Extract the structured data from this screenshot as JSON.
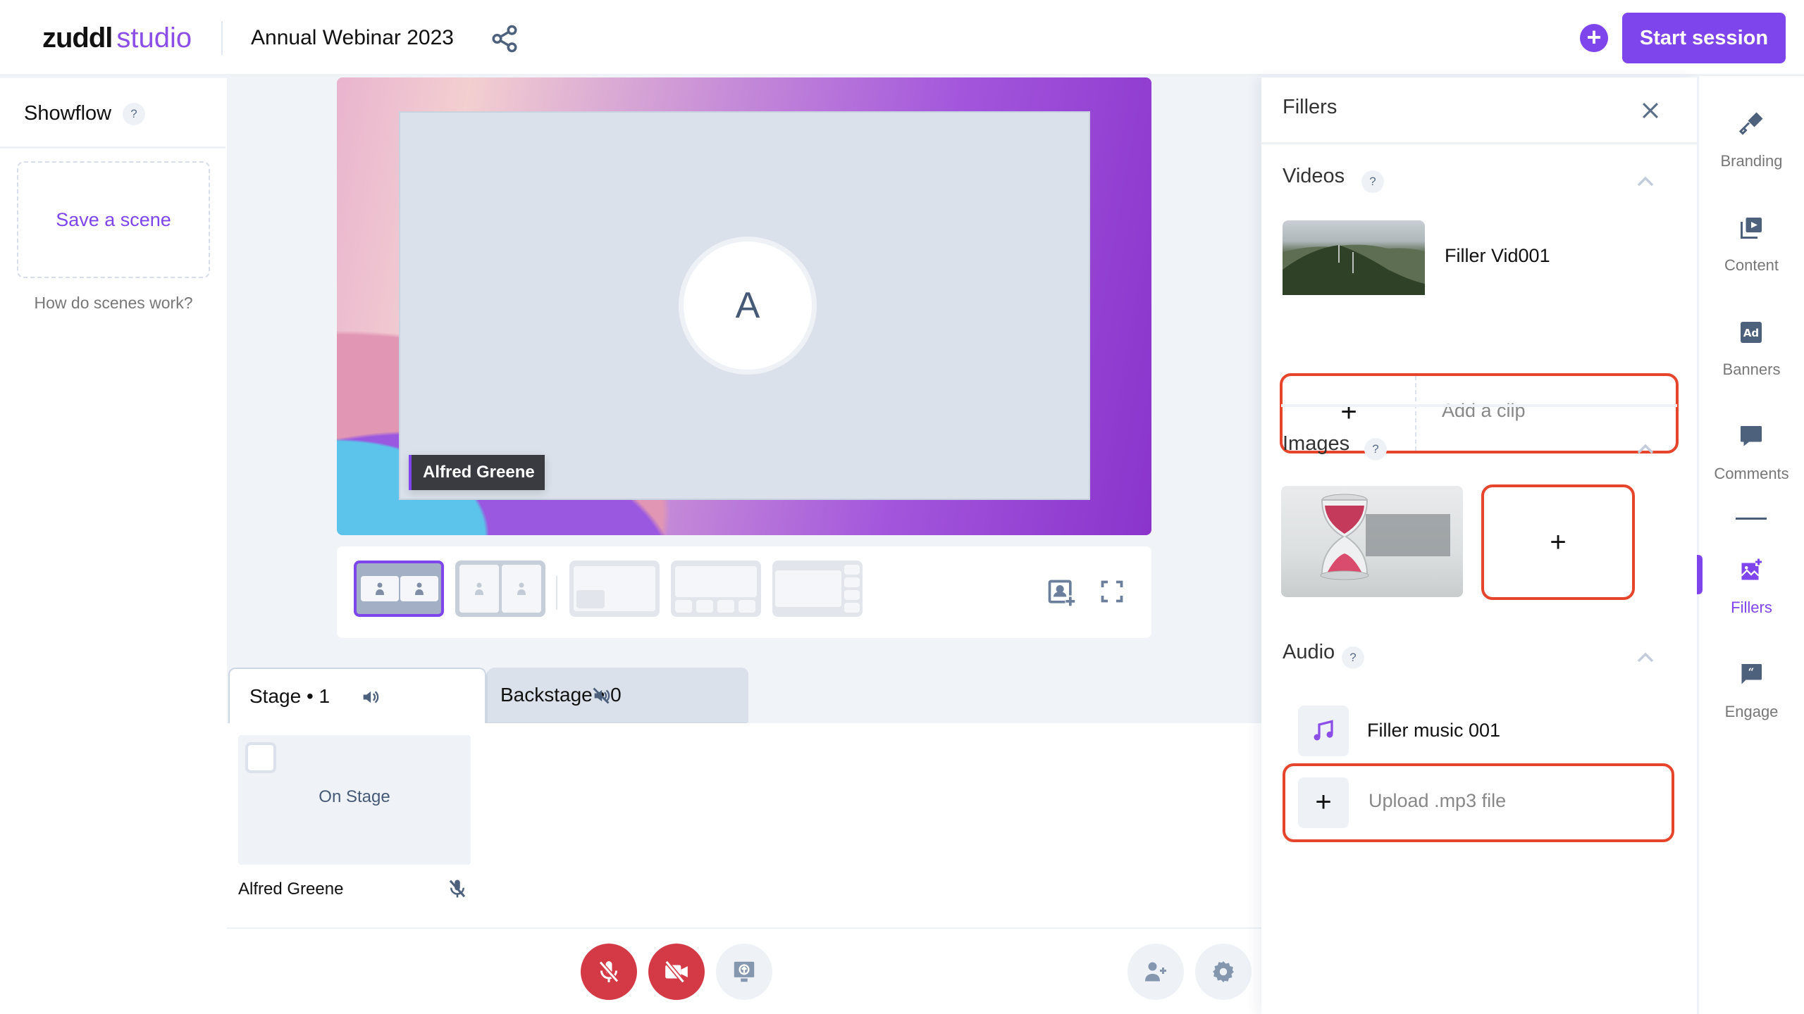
{
  "header": {
    "brand": "zuddl",
    "product": "studio",
    "event_title": "Annual Webinar 2023",
    "share_icon": "share-icon",
    "add_icon": "plus-circle-icon",
    "start_session_label": "Start session",
    "accent_color": "#7f45ec"
  },
  "showflow": {
    "title": "Showflow",
    "help": "?",
    "save_scene_label": "Save a scene",
    "help_link": "How do scenes work?"
  },
  "stage": {
    "avatar_initial": "A",
    "name_tag": "Alfred Greene",
    "layouts": [
      {
        "name": "two-up-side-by-side",
        "selected": true
      },
      {
        "name": "two-up-full",
        "selected": false
      },
      {
        "name": "picture-in-picture",
        "selected": false
      },
      {
        "name": "main-with-bottom-strip",
        "selected": false
      },
      {
        "name": "main-with-side-strip",
        "selected": false
      }
    ],
    "tools": [
      "add-to-stage-icon",
      "fullscreen-icon"
    ]
  },
  "tabs": [
    {
      "label": "Stage • 1",
      "icon": "speaker-on-icon",
      "active": true
    },
    {
      "label": "Backstage • 0",
      "icon": "speaker-muted-icon",
      "active": false
    }
  ],
  "participants": [
    {
      "name": "Alfred Greene",
      "status": "On Stage",
      "mic": "muted"
    }
  ],
  "controls": {
    "left": [
      {
        "name": "mic-off",
        "state": "off",
        "color": "#d33a46"
      },
      {
        "name": "camera-off",
        "state": "off",
        "color": "#d33a46"
      },
      {
        "name": "share-screen",
        "state": "idle"
      }
    ],
    "right": [
      {
        "name": "invite-person"
      },
      {
        "name": "settings"
      }
    ]
  },
  "fillers": {
    "title": "Fillers",
    "videos": {
      "title": "Videos",
      "help": "?",
      "items": [
        {
          "name": "Filler Vid001"
        }
      ],
      "add_label": "+",
      "add_text": "Add a clip"
    },
    "images": {
      "title": "Images",
      "help": "?",
      "items": [
        {
          "name": "hourglass"
        }
      ],
      "add_label": "+"
    },
    "audio": {
      "title": "Audio",
      "help": "?",
      "items": [
        {
          "name": "Filler music 001"
        }
      ],
      "add_label": "+",
      "add_text": "Upload .mp3 file"
    },
    "highlight_color": "#e6452c"
  },
  "rail": {
    "items": [
      {
        "label": "Branding",
        "icon": "paint-roller-icon",
        "active": false
      },
      {
        "label": "Content",
        "icon": "video-library-icon",
        "active": false
      },
      {
        "label": "Banners",
        "icon": "ad-icon",
        "active": false
      },
      {
        "label": "Comments",
        "icon": "comment-icon",
        "active": false
      },
      {
        "label": "Fillers",
        "icon": "image-add-icon",
        "active": true
      },
      {
        "label": "Engage",
        "icon": "quote-bubble-icon",
        "active": false
      }
    ]
  }
}
